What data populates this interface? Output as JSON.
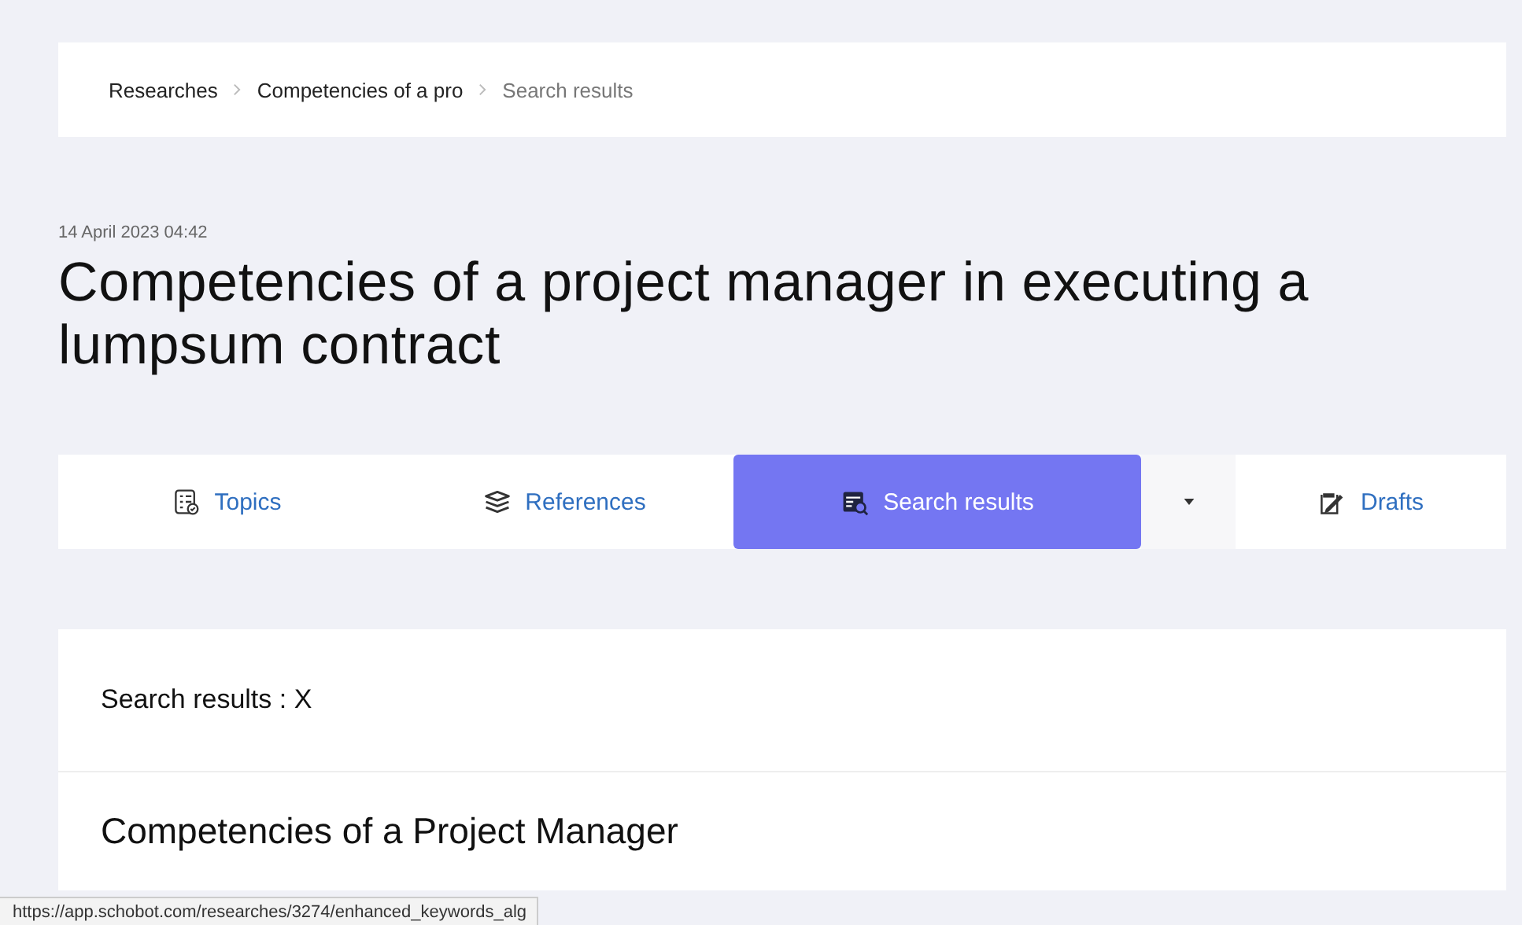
{
  "breadcrumbs": [
    {
      "label": "Researches",
      "current": false
    },
    {
      "label": "Competencies of a pro",
      "current": false
    },
    {
      "label": "Search results",
      "current": true
    }
  ],
  "date": "14 April 2023 04:42",
  "title": "Competencies of a project manager in executing a lumpsum contract",
  "tabs": [
    {
      "label": "Topics",
      "selected": false
    },
    {
      "label": "References",
      "selected": false
    },
    {
      "label": "Search results",
      "selected": true,
      "dropdown": true
    },
    {
      "label": "Drafts",
      "selected": false
    }
  ],
  "results": {
    "heading": "Search results : X",
    "first_title": "Competencies of a Project Manager"
  },
  "status_bar": {
    "url": "https://app.schobot.com/researches/3274/enhanced_keywords_alg"
  }
}
